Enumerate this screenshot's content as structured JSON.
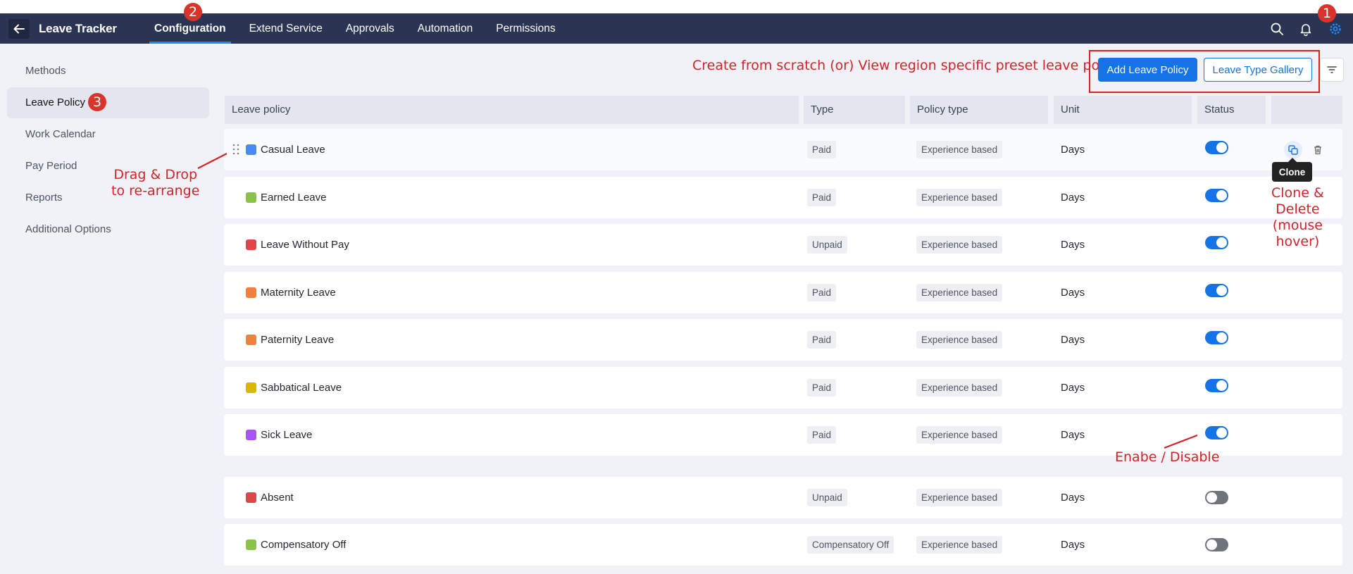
{
  "app": {
    "title": "Leave Tracker"
  },
  "nav": {
    "tabs": [
      {
        "label": "Configuration",
        "active": true
      },
      {
        "label": "Extend Service"
      },
      {
        "label": "Approvals"
      },
      {
        "label": "Automation"
      },
      {
        "label": "Permissions"
      }
    ]
  },
  "topbar_icons": [
    "search-icon",
    "bell-icon",
    "settings-icon"
  ],
  "sidebar": {
    "items": [
      {
        "label": "Methods"
      },
      {
        "label": "Leave Policy",
        "active": true
      },
      {
        "label": "Work Calendar"
      },
      {
        "label": "Pay Period"
      },
      {
        "label": "Reports"
      },
      {
        "label": "Additional Options"
      }
    ]
  },
  "toolbar": {
    "add_label": "Add Leave Policy",
    "gallery_label": "Leave Type Gallery"
  },
  "table": {
    "headers": [
      "Leave policy",
      "Type",
      "Policy type",
      "Unit",
      "Status"
    ],
    "rows": [
      {
        "name": "Casual Leave",
        "color": "#4a8af4",
        "type": "Paid",
        "policy_type": "Experience based",
        "unit": "Days",
        "enabled": true
      },
      {
        "name": "Earned Leave",
        "color": "#8bc34a",
        "type": "Paid",
        "policy_type": "Experience based",
        "unit": "Days",
        "enabled": true
      },
      {
        "name": "Leave Without Pay",
        "color": "#e0454a",
        "type": "Unpaid",
        "policy_type": "Experience based",
        "unit": "Days",
        "enabled": true
      },
      {
        "name": "Maternity Leave",
        "color": "#f08040",
        "type": "Paid",
        "policy_type": "Experience based",
        "unit": "Days",
        "enabled": true
      },
      {
        "name": "Paternity Leave",
        "color": "#f08040",
        "type": "Paid",
        "policy_type": "Experience based",
        "unit": "Days",
        "enabled": true
      },
      {
        "name": "Sabbatical Leave",
        "color": "#d8b800",
        "type": "Paid",
        "policy_type": "Experience based",
        "unit": "Days",
        "enabled": true
      },
      {
        "name": "Sick Leave",
        "color": "#a855f7",
        "type": "Paid",
        "policy_type": "Experience based",
        "unit": "Days",
        "enabled": true
      },
      {
        "name": "Absent",
        "color": "#e0454a",
        "type": "Unpaid",
        "policy_type": "Experience based",
        "unit": "Days",
        "enabled": false
      },
      {
        "name": "Compensatory Off",
        "color": "#8bc34a",
        "type": "Compensatory Off",
        "policy_type": "Experience based",
        "unit": "Days",
        "enabled": false
      }
    ]
  },
  "tooltip": {
    "clone": "Clone"
  },
  "annotations": {
    "create": "Create from scratch (or) View region specific preset leave policies",
    "drag": [
      "Drag & Drop",
      "to re-arrange"
    ],
    "clone_delete": [
      "Clone &",
      "Delete",
      "(mouse",
      "hover)"
    ],
    "enable": "Enabe / Disable",
    "badges": [
      "1",
      "2",
      "3"
    ]
  },
  "colors": {
    "topbar": "#2a3553",
    "accent": "#1473e6",
    "annotation": "#d2232a"
  }
}
